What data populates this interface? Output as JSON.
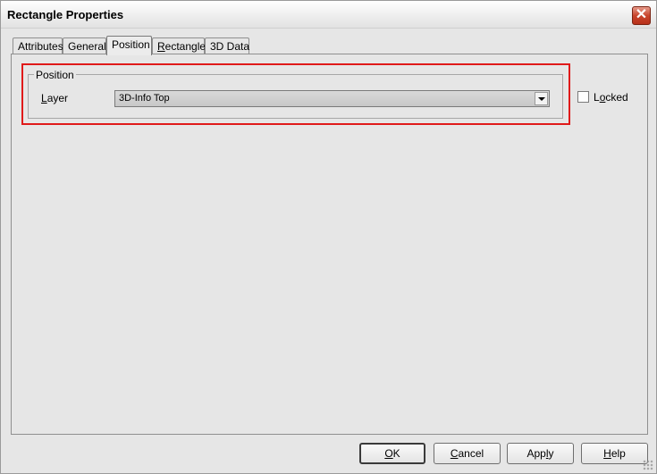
{
  "window": {
    "title": "Rectangle Properties",
    "close_glyph": "✕"
  },
  "tabs": [
    {
      "label_pre": "Attributes",
      "label_u": "",
      "label_post": "",
      "active": false
    },
    {
      "label_pre": "General",
      "label_u": "",
      "label_post": "",
      "active": false
    },
    {
      "label_pre": "Position",
      "label_u": "",
      "label_post": "",
      "active": true
    },
    {
      "label_pre": "",
      "label_u": "R",
      "label_post": "ectangle",
      "active": false
    },
    {
      "label_pre": "3D Data",
      "label_u": "",
      "label_post": "",
      "active": false
    }
  ],
  "position_group": {
    "title": "Position",
    "layer_label_u": "L",
    "layer_label_rest": "ayer",
    "layer_value": "3D-Info Top"
  },
  "locked": {
    "label_u": "o",
    "label_pre": "L",
    "label_post": "cked",
    "checked": false
  },
  "buttons": {
    "ok_u": "O",
    "ok_rest": "K",
    "cancel_u": "C",
    "cancel_rest": "ancel",
    "apply_pre": "App",
    "apply_u": "l",
    "apply_post": "y",
    "help_u": "H",
    "help_rest": "elp"
  },
  "colors": {
    "highlight": "#e01a1a",
    "close_button": "#c9452c"
  }
}
